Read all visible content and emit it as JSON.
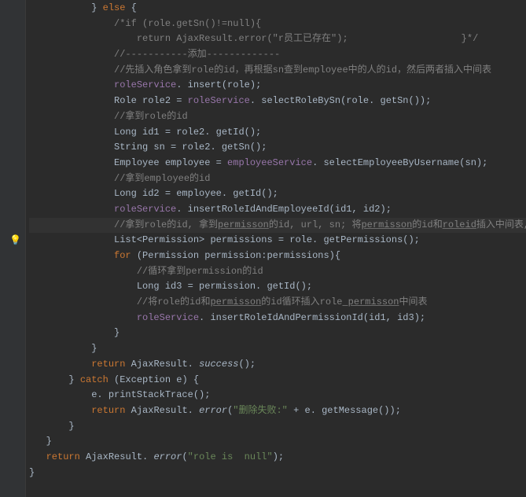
{
  "gutter": {
    "bulb_icon": "💡",
    "bulb_line_index": 15
  },
  "lines": [
    [
      [
        "typ",
        "           } "
      ],
      [
        "kw",
        "else"
      ],
      [
        "typ",
        " {"
      ]
    ],
    [
      [
        "typ",
        "               "
      ],
      [
        "cmt",
        "/*if (role.getSn()!=null){"
      ]
    ],
    [
      [
        "typ",
        "                   "
      ],
      [
        "cmt",
        "return AjaxResult.error(\"r员工已存在\");                    }*/"
      ]
    ],
    [
      [
        "typ",
        "               "
      ],
      [
        "cmt",
        "//-----------添加-------------"
      ]
    ],
    [
      [
        "typ",
        "               "
      ],
      [
        "cmt",
        "//先插入角色拿到role的id，再根据sn查到employee中的人的id，然后两者插入中间表"
      ]
    ],
    [
      [
        "typ",
        "               "
      ],
      [
        "fld",
        "roleService"
      ],
      [
        "typ",
        ". insert(role);"
      ]
    ],
    [
      [
        "typ",
        "               Role role2 = "
      ],
      [
        "fld",
        "roleService"
      ],
      [
        "typ",
        ". selectRoleBySn(role. getSn());"
      ]
    ],
    [
      [
        "typ",
        "               "
      ],
      [
        "cmt",
        "//拿到role的id"
      ]
    ],
    [
      [
        "typ",
        "               Long id1 = role2. getId();"
      ]
    ],
    [
      [
        "typ",
        "               String sn = role2. getSn();"
      ]
    ],
    [
      [
        "typ",
        "               Employee employee = "
      ],
      [
        "fld",
        "employeeService"
      ],
      [
        "typ",
        ". selectEmployeeByUsername(sn);"
      ]
    ],
    [
      [
        "typ",
        "               "
      ],
      [
        "cmt",
        "//拿到employee的id"
      ]
    ],
    [
      [
        "typ",
        "               Long id2 = employee. getId();"
      ]
    ],
    [
      [
        "typ",
        "               "
      ],
      [
        "fld",
        "roleService"
      ],
      [
        "typ",
        ". insertRoleIdAndEmployeeId(id1, id2);"
      ]
    ],
    [
      [
        "typ",
        "               "
      ],
      [
        "cmt",
        "//拿到role的id, 拿到"
      ],
      [
        "cmtu",
        "permisson"
      ],
      [
        "cmt",
        "的id, url, sn; 将"
      ],
      [
        "cmtu",
        "permisson"
      ],
      [
        "cmt",
        "的id和"
      ],
      [
        "cmtu",
        "roleid"
      ],
      [
        "cmt",
        "插入中间表,"
      ]
    ],
    [
      [
        "typ",
        "               List<Permission> permissions = role. getPermissions();"
      ]
    ],
    [
      [
        "typ",
        "               "
      ],
      [
        "kw",
        "for"
      ],
      [
        "typ",
        " (Permission permission:permissions){"
      ]
    ],
    [
      [
        "typ",
        "                   "
      ],
      [
        "cmt",
        "//循环拿到permission的id"
      ]
    ],
    [
      [
        "typ",
        "                   Long id3 = permission. getId();"
      ]
    ],
    [
      [
        "typ",
        "                   "
      ],
      [
        "cmt",
        "//将role的id和"
      ],
      [
        "cmtu",
        "permisson"
      ],
      [
        "cmt",
        "的id循环插入role"
      ],
      [
        "cmtu",
        " permisson"
      ],
      [
        "cmt",
        "中间表"
      ]
    ],
    [
      [
        "typ",
        "                   "
      ],
      [
        "fld",
        "roleService"
      ],
      [
        "typ",
        ". insertRoleIdAndPermissionId(id1, id3);"
      ]
    ],
    [
      [
        "typ",
        "               }"
      ]
    ],
    [
      [
        "typ",
        "           }"
      ]
    ],
    [
      [
        "typ",
        "           "
      ],
      [
        "kw",
        "return"
      ],
      [
        "typ",
        " AjaxResult. "
      ],
      [
        "sta",
        "success"
      ],
      [
        "typ",
        "();"
      ]
    ],
    [
      [
        "typ",
        "       } "
      ],
      [
        "kw",
        "catch"
      ],
      [
        "typ",
        " (Exception e) {"
      ]
    ],
    [
      [
        "typ",
        "           e. printStackTrace();"
      ]
    ],
    [
      [
        "typ",
        "           "
      ],
      [
        "kw",
        "return"
      ],
      [
        "typ",
        " AjaxResult. "
      ],
      [
        "sta",
        "error"
      ],
      [
        "typ",
        "("
      ],
      [
        "str",
        "\"删除失败:\""
      ],
      [
        "typ",
        " + e. getMessage());"
      ]
    ],
    [
      [
        "typ",
        "       }"
      ]
    ],
    [
      [
        "typ",
        "   }"
      ]
    ],
    [
      [
        "typ",
        "   "
      ],
      [
        "kw",
        "return"
      ],
      [
        "typ",
        " AjaxResult. "
      ],
      [
        "sta",
        "error"
      ],
      [
        "typ",
        "("
      ],
      [
        "str",
        "\"role is  null\""
      ],
      [
        "typ",
        ");"
      ]
    ],
    [
      [
        "typ",
        "}"
      ]
    ]
  ],
  "highlight_line_index": 14
}
